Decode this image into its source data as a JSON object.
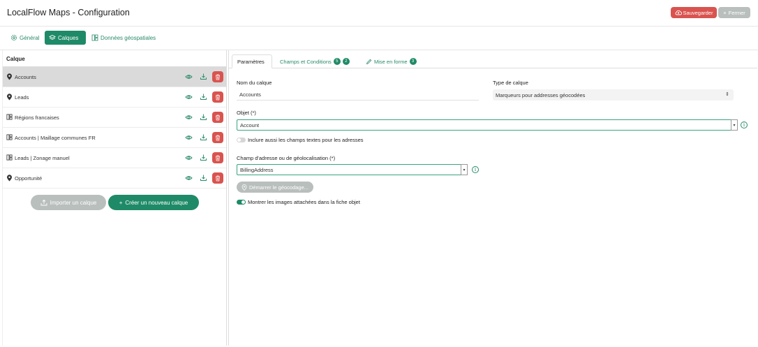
{
  "header": {
    "title": "LocalFlow Maps - Configuration",
    "save_label": "Sauvegarder",
    "close_label": "Fermer"
  },
  "main_tabs": [
    {
      "label": "Général",
      "icon": "gear-icon"
    },
    {
      "label": "Calques",
      "icon": "layers-icon",
      "active": true
    },
    {
      "label": "Données géospatiales",
      "icon": "grid-icon"
    }
  ],
  "layers_panel": {
    "header": "Calque",
    "items": [
      {
        "name": "Accounts",
        "icon": "map-pin-icon",
        "selected": true
      },
      {
        "name": "Leads",
        "icon": "map-pin-icon"
      },
      {
        "name": "Régions francaises",
        "icon": "grid-icon"
      },
      {
        "name": "Accounts | Maillage communes FR",
        "icon": "grid-icon"
      },
      {
        "name": "Leads | Zonage manuel",
        "icon": "grid-icon"
      },
      {
        "name": "Opportunité",
        "icon": "map-pin-icon"
      }
    ],
    "import_label": "Importer un calque",
    "create_label": "Créer un nouveau calque"
  },
  "settings": {
    "tabs": [
      {
        "label": "Paramètres",
        "active": true
      },
      {
        "label": "Champs et Conditions",
        "badges": [
          "5",
          "2"
        ]
      },
      {
        "label": "Mise en forme",
        "badges": [
          "3"
        ]
      }
    ],
    "layer_name_label": "Nom du calque",
    "layer_name_value": "Accounts",
    "layer_type_label": "Type de calque",
    "layer_type_value": "Marqueurs pour addresses géocodées",
    "object_label": "Objet (*)",
    "object_value": "Account",
    "include_text_label": "Inclure aussi les champs textes pour les adresses",
    "include_text_on": false,
    "address_field_label": "Champ d'adresse ou de géolocalisation (*)",
    "address_field_value": "BillingAddress",
    "geocode_label": "Démarrer le géocodage...",
    "show_images_label": "Montrer les images attachées dans la fiche objet",
    "show_images_on": true
  },
  "colors": {
    "accent": "#1f8a67",
    "danger": "#d9534f",
    "disabled": "#b9bfbc"
  }
}
